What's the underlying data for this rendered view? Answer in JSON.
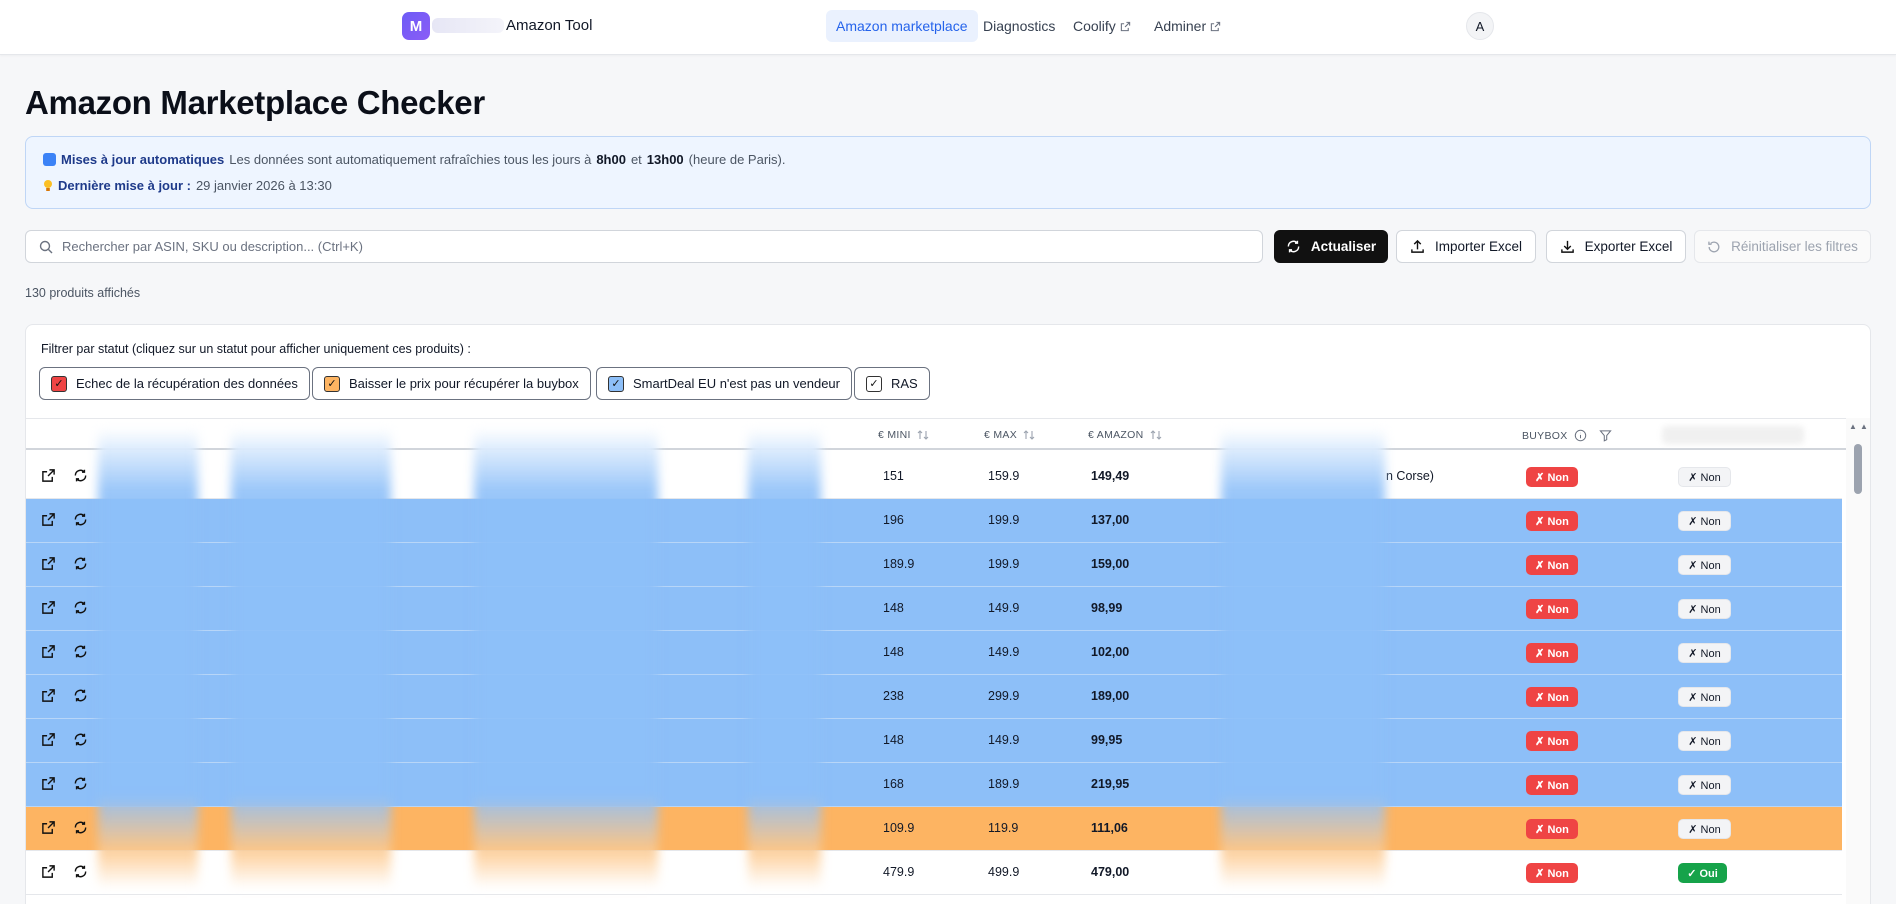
{
  "nav": {
    "logo_letter": "M",
    "app_name": "Amazon Tool",
    "items": [
      {
        "label": "Amazon marketplace",
        "active": true,
        "external": false
      },
      {
        "label": "Diagnostics",
        "active": false,
        "external": false
      },
      {
        "label": "Coolify",
        "active": false,
        "external": true
      },
      {
        "label": "Adminer",
        "active": false,
        "external": true
      }
    ],
    "avatar_letter": "A"
  },
  "page": {
    "title": "Amazon Marketplace Checker"
  },
  "info": {
    "auto_label": "Mises à jour automatiques",
    "auto_text_1": "Les données sont automatiquement rafraîchies tous les jours à",
    "time_1": "8h00",
    "auto_text_and": "et",
    "time_2": "13h00",
    "auto_text_2": "(heure de Paris).",
    "last_label": "Dernière mise à jour :",
    "last_value": "29 janvier 2026 à 13:30"
  },
  "search": {
    "placeholder": "Rechercher par ASIN, SKU ou description... (Ctrl+K)"
  },
  "toolbar": {
    "refresh_label": "Actualiser",
    "import_label": "Importer Excel",
    "export_label": "Exporter Excel",
    "reset_label": "Réinitialiser les filtres"
  },
  "count_text": "130 produits affichés",
  "filters": {
    "title": "Filtrer par statut (cliquez sur un statut pour afficher uniquement ces produits) :",
    "chips": [
      {
        "label": "Echec de la récupération des données",
        "color": "#ef4444",
        "check": "✓"
      },
      {
        "label": "Baisser le prix pour récupérer la buybox",
        "color": "#fdb462",
        "check": "✓"
      },
      {
        "label": "SmartDeal EU n'est pas un vendeur",
        "color": "#8dbff8",
        "check": "✓"
      },
      {
        "label": "RAS",
        "color": "#ffffff",
        "check": "✓"
      }
    ]
  },
  "table": {
    "headers": {
      "min": "€ MINI",
      "max": "€ MAX",
      "amazon": "€ AMAZON",
      "buybox": "BUYBOX"
    },
    "first_row_partial_text": "n Corse)",
    "rows": [
      {
        "min": "151",
        "max": "159.9",
        "amazon": "149,49",
        "color": "white",
        "buybox": "✗ Non",
        "last": "✗ Non"
      },
      {
        "min": "196",
        "max": "199.9",
        "amazon": "137,00",
        "color": "blue",
        "buybox": "✗ Non",
        "last": "✗ Non"
      },
      {
        "min": "189.9",
        "max": "199.9",
        "amazon": "159,00",
        "color": "blue",
        "buybox": "✗ Non",
        "last": "✗ Non"
      },
      {
        "min": "148",
        "max": "149.9",
        "amazon": "98,99",
        "color": "blue",
        "buybox": "✗ Non",
        "last": "✗ Non"
      },
      {
        "min": "148",
        "max": "149.9",
        "amazon": "102,00",
        "color": "blue",
        "buybox": "✗ Non",
        "last": "✗ Non"
      },
      {
        "min": "238",
        "max": "299.9",
        "amazon": "189,00",
        "color": "blue",
        "buybox": "✗ Non",
        "last": "✗ Non"
      },
      {
        "min": "148",
        "max": "149.9",
        "amazon": "99,95",
        "color": "blue",
        "buybox": "✗ Non",
        "last": "✗ Non"
      },
      {
        "min": "168",
        "max": "189.9",
        "amazon": "219,95",
        "color": "blue",
        "buybox": "✗ Non",
        "last": "✗ Non"
      },
      {
        "min": "109.9",
        "max": "119.9",
        "amazon": "111,06",
        "color": "orange",
        "buybox": "✗ Non",
        "last": "✗ Non"
      },
      {
        "min": "479.9",
        "max": "499.9",
        "amazon": "479,00",
        "color": "white",
        "buybox": "✗ Non",
        "last": "✓ Oui"
      }
    ]
  }
}
